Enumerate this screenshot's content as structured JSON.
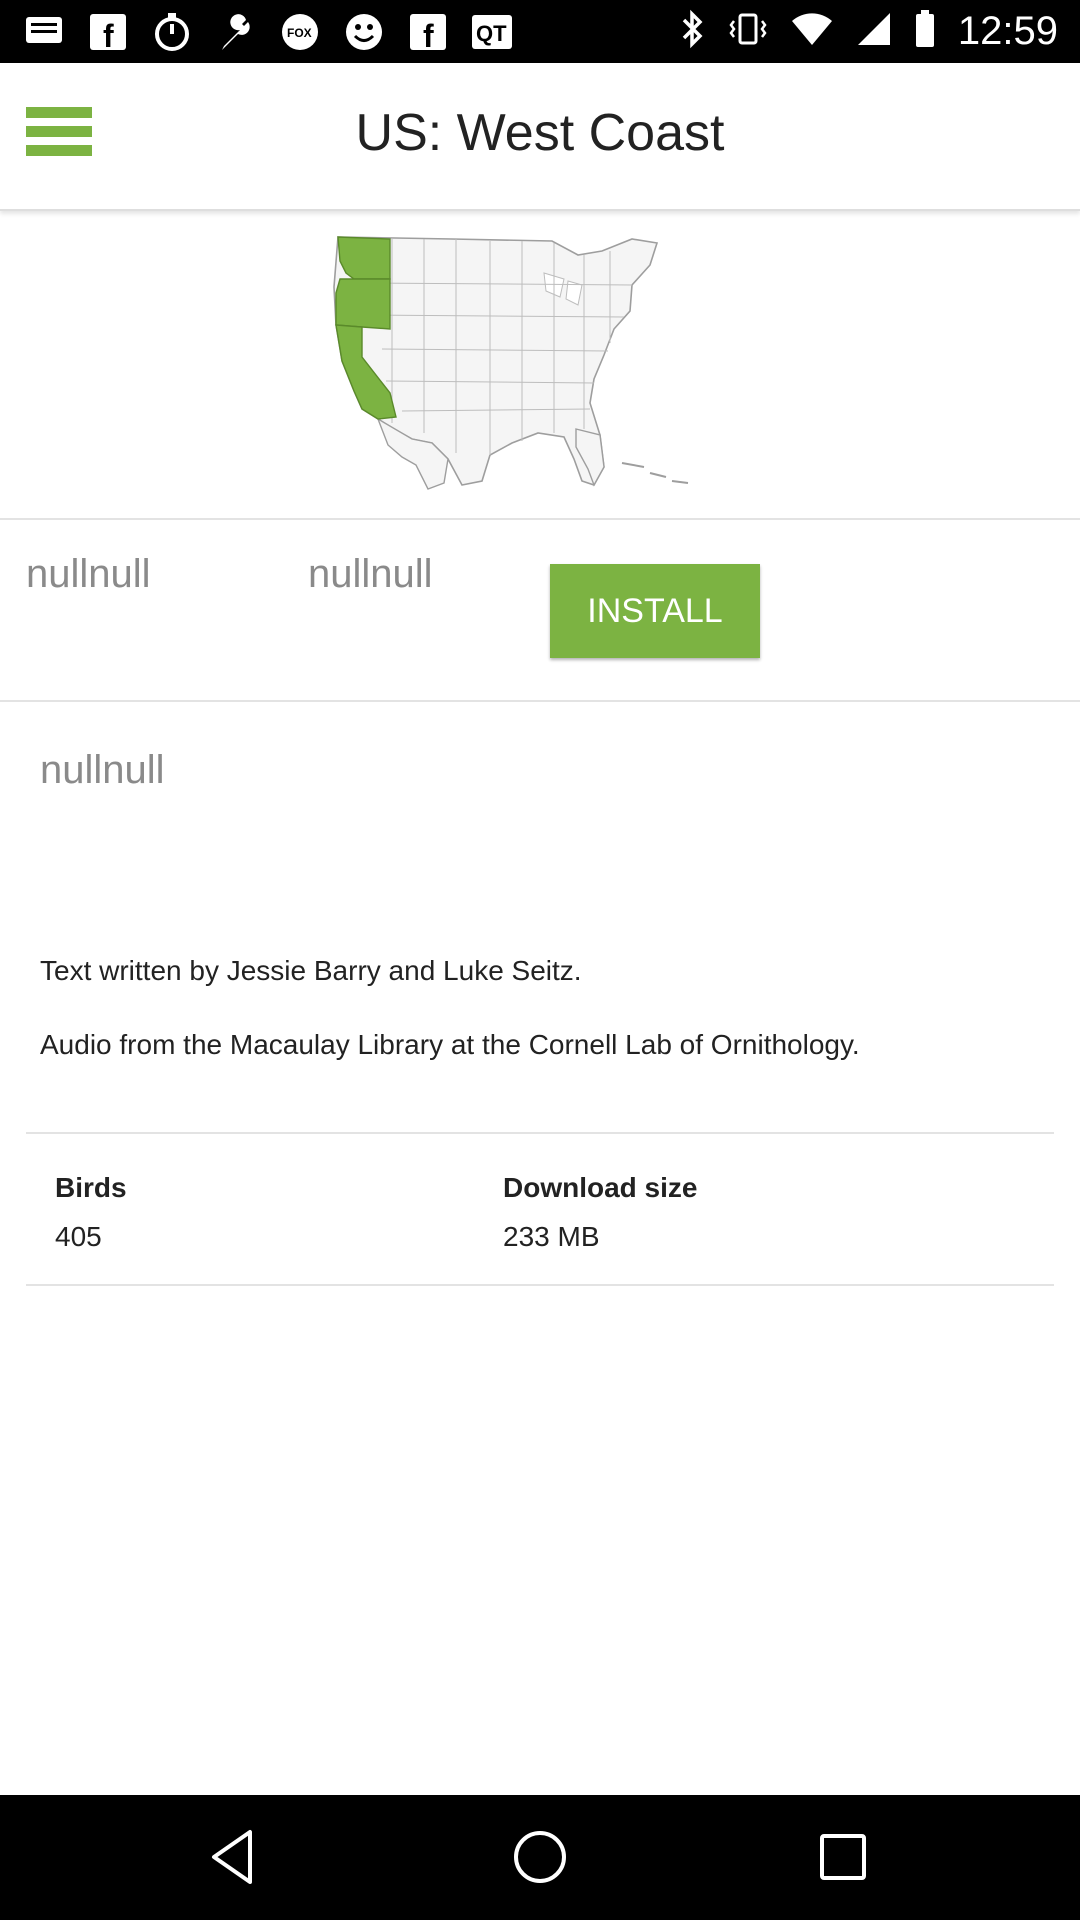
{
  "status_bar": {
    "time": "12:59",
    "left_icons": [
      "message-icon",
      "facebook-icon",
      "timer-icon",
      "wrench-icon",
      "fox-sports-icon",
      "smiley-icon",
      "facebook-icon",
      "qt-icon"
    ],
    "right_icons": [
      "bluetooth-icon",
      "vibrate-icon",
      "wifi-icon",
      "signal-icon",
      "battery-icon"
    ]
  },
  "app_bar": {
    "title": "US: West Coast",
    "menu_icon": "hamburger-menu-icon"
  },
  "map": {
    "region": "US West Coast",
    "highlight_color": "#7cb342",
    "highlighted_states": [
      "Washington",
      "Oregon",
      "California"
    ]
  },
  "actions": {
    "null_label_1": "nullnull",
    "null_label_2": "nullnull",
    "install_label": "INSTALL"
  },
  "description": {
    "null_text": "nullnull",
    "credits_text": "Text written by Jessie Barry and Luke Seitz.",
    "audio_credit": "Audio from the Macaulay Library at the Cornell Lab of Ornithology."
  },
  "info": {
    "birds_label": "Birds",
    "birds_value": "405",
    "size_label": "Download size",
    "size_value": "233 MB"
  },
  "nav_bar": {
    "back_icon": "back-icon",
    "home_icon": "home-icon",
    "recents_icon": "recents-icon"
  },
  "colors": {
    "accent": "#7cb342",
    "muted_text": "#8a8a8a",
    "text": "#222222"
  }
}
